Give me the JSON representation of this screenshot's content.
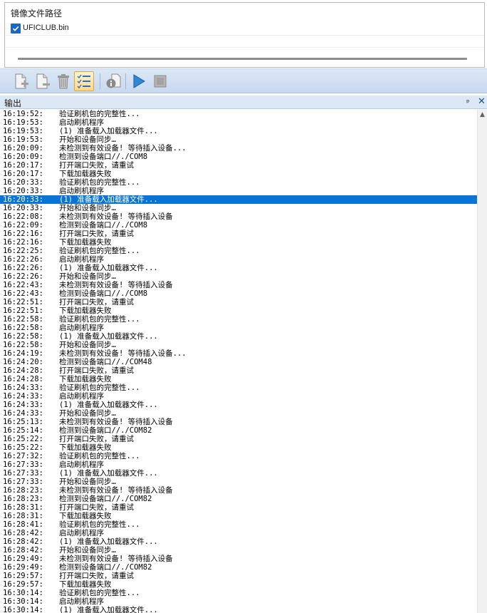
{
  "file_panel": {
    "header": "镜像文件路径",
    "file": {
      "checked": true,
      "name": "UFICLUB.bin"
    }
  },
  "toolbar": {
    "buttons": [
      {
        "icon": "add-file-icon"
      },
      {
        "icon": "remove-file-icon"
      },
      {
        "icon": "trash-icon"
      },
      {
        "icon": "checklist-icon",
        "active": true
      },
      {
        "icon": "info-icon"
      },
      {
        "icon": "play-icon"
      },
      {
        "icon": "stop-icon"
      }
    ]
  },
  "output": {
    "title": "输出",
    "pin_glyph": "ᵖ",
    "close_glyph": "✕",
    "selected_index": 10,
    "rows": [
      {
        "time": "16:19:52:",
        "msg": "验证刷机包的完整性..."
      },
      {
        "time": "16:19:53:",
        "msg": "启动刷机程序"
      },
      {
        "time": "16:19:53:",
        "msg": "(1) 准备载入加载器文件..."
      },
      {
        "time": "16:19:53:",
        "msg": "开始和设备同步…"
      },
      {
        "time": "16:20:09:",
        "msg": "未检测到有效设备! 等待插入设备..."
      },
      {
        "time": "16:20:09:",
        "msg": "检测到设备端口//./COM8"
      },
      {
        "time": "16:20:17:",
        "msg": "打开端口失败，请重试"
      },
      {
        "time": "16:20:17:",
        "msg": "下载加载器失败"
      },
      {
        "time": "16:20:33:",
        "msg": "验证刷机包的完整性..."
      },
      {
        "time": "16:20:33:",
        "msg": "启动刷机程序"
      },
      {
        "time": "16:20:33:",
        "msg": "(1) 准备载入加载器文件..."
      },
      {
        "time": "16:20:33:",
        "msg": "开始和设备同步…"
      },
      {
        "time": "16:22:08:",
        "msg": "未检测到有效设备! 等待插入设备"
      },
      {
        "time": "16:22:09:",
        "msg": "检测到设备端口//./COM8"
      },
      {
        "time": "16:22:16:",
        "msg": "打开端口失败，请重试"
      },
      {
        "time": "16:22:16:",
        "msg": "下载加载器失败"
      },
      {
        "time": "16:22:25:",
        "msg": "验证刷机包的完整性..."
      },
      {
        "time": "16:22:26:",
        "msg": "启动刷机程序"
      },
      {
        "time": "16:22:26:",
        "msg": "(1) 准备载入加载器文件..."
      },
      {
        "time": "16:22:26:",
        "msg": "开始和设备同步…"
      },
      {
        "time": "16:22:43:",
        "msg": "未检测到有效设备! 等待插入设备"
      },
      {
        "time": "16:22:43:",
        "msg": "检测到设备端口//./COM8"
      },
      {
        "time": "16:22:51:",
        "msg": "打开端口失败，请重试"
      },
      {
        "time": "16:22:51:",
        "msg": "下载加载器失败"
      },
      {
        "time": "16:22:58:",
        "msg": "验证刷机包的完整性..."
      },
      {
        "time": "16:22:58:",
        "msg": "启动刷机程序"
      },
      {
        "time": "16:22:58:",
        "msg": "(1) 准备载入加载器文件..."
      },
      {
        "time": "16:22:58:",
        "msg": "开始和设备同步…"
      },
      {
        "time": "16:24:19:",
        "msg": "未检测到有效设备! 等待插入设备..."
      },
      {
        "time": "16:24:20:",
        "msg": "检测到设备端口//./COM48"
      },
      {
        "time": "16:24:28:",
        "msg": "打开端口失败，请重试"
      },
      {
        "time": "16:24:28:",
        "msg": "下载加载器失败"
      },
      {
        "time": "16:24:33:",
        "msg": "验证刷机包的完整性..."
      },
      {
        "time": "16:24:33:",
        "msg": "启动刷机程序"
      },
      {
        "time": "16:24:33:",
        "msg": "(1) 准备载入加载器文件..."
      },
      {
        "time": "16:24:33:",
        "msg": "开始和设备同步…"
      },
      {
        "time": "16:25:13:",
        "msg": "未检测到有效设备! 等待插入设备"
      },
      {
        "time": "16:25:14:",
        "msg": "检测到设备端口//./COM82"
      },
      {
        "time": "16:25:22:",
        "msg": "打开端口失败，请重试"
      },
      {
        "time": "16:25:22:",
        "msg": "下载加载器失败"
      },
      {
        "time": "16:27:32:",
        "msg": "验证刷机包的完整性..."
      },
      {
        "time": "16:27:33:",
        "msg": "启动刷机程序"
      },
      {
        "time": "16:27:33:",
        "msg": "(1) 准备载入加载器文件..."
      },
      {
        "time": "16:27:33:",
        "msg": "开始和设备同步…"
      },
      {
        "time": "16:28:23:",
        "msg": "未检测到有效设备! 等待插入设备"
      },
      {
        "time": "16:28:23:",
        "msg": "检测到设备端口//./COM82"
      },
      {
        "time": "16:28:31:",
        "msg": "打开端口失败，请重试"
      },
      {
        "time": "16:28:31:",
        "msg": "下载加载器失败"
      },
      {
        "time": "16:28:41:",
        "msg": "验证刷机包的完整性..."
      },
      {
        "time": "16:28:42:",
        "msg": "启动刷机程序"
      },
      {
        "time": "16:28:42:",
        "msg": "(1) 准备载入加载器文件..."
      },
      {
        "time": "16:28:42:",
        "msg": "开始和设备同步…"
      },
      {
        "time": "16:29:49:",
        "msg": "未检测到有效设备! 等待插入设备"
      },
      {
        "time": "16:29:49:",
        "msg": "检测到设备端口//./COM82"
      },
      {
        "time": "16:29:57:",
        "msg": "打开端口失败，请重试"
      },
      {
        "time": "16:29:57:",
        "msg": "下载加载器失败"
      },
      {
        "time": "16:30:14:",
        "msg": "验证刷机包的完整性..."
      },
      {
        "time": "16:30:14:",
        "msg": "启动刷机程序"
      },
      {
        "time": "16:30:14:",
        "msg": "(1) 准备载入加载器文件..."
      }
    ]
  },
  "colors": {
    "selection": "#0a74d6",
    "toolbar_bg": "#cfdff3",
    "checkbox": "#1b67c4"
  }
}
